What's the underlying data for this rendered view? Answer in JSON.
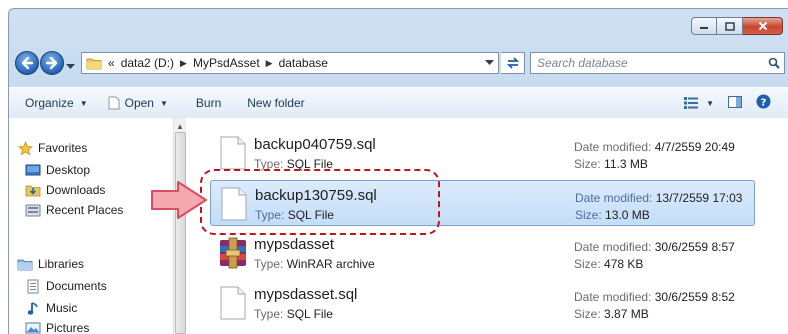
{
  "breadcrumb": {
    "overflow": "«",
    "items": [
      "data2 (D:)",
      "MyPsdAsset",
      "database"
    ]
  },
  "search": {
    "placeholder": "Search database"
  },
  "toolbar": {
    "organize": "Organize",
    "open": "Open",
    "burn": "Burn",
    "new_folder": "New folder"
  },
  "nav": {
    "favorites": "Favorites",
    "desktop": "Desktop",
    "downloads": "Downloads",
    "recent": "Recent Places",
    "libraries": "Libraries",
    "documents": "Documents",
    "music": "Music",
    "pictures": "Pictures"
  },
  "labels": {
    "type": "Type:",
    "date_modified": "Date modified:",
    "size": "Size:"
  },
  "files": [
    {
      "name": "backup040759.sql",
      "type": "SQL File",
      "modified": "4/7/2559 20:49",
      "size": "11.3 MB",
      "icon": "document-icon",
      "selected": false
    },
    {
      "name": "backup130759.sql",
      "type": "SQL File",
      "modified": "13/7/2559 17:03",
      "size": "13.0 MB",
      "icon": "document-icon",
      "selected": true
    },
    {
      "name": "mypsdasset",
      "type": "WinRAR archive",
      "modified": "30/6/2559 8:57",
      "size": "478 KB",
      "icon": "winrar-icon",
      "selected": false
    },
    {
      "name": "mypsdasset.sql",
      "type": "SQL File",
      "modified": "30/6/2559 8:52",
      "size": "3.87 MB",
      "icon": "document-icon",
      "selected": false
    }
  ],
  "colors": {
    "selection": "#c4ddf8",
    "highlight_dash": "#c0161b",
    "arrow": "#f0a0a8"
  }
}
